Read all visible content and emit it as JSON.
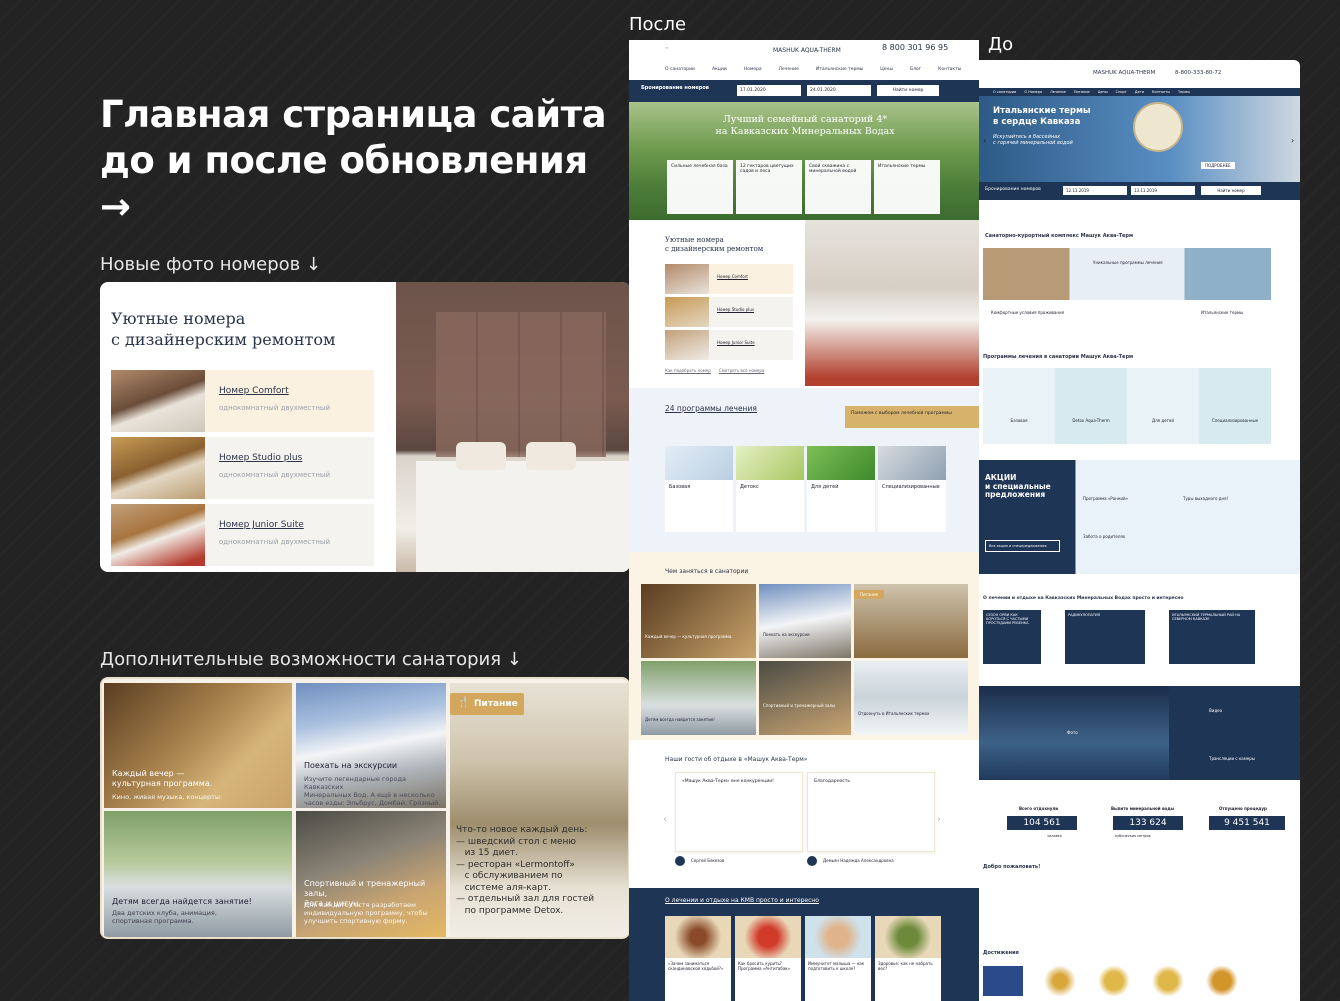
{
  "headline": [
    "Главная страница сайта",
    "до и после обновления →"
  ],
  "labels": {
    "after": "После",
    "before": "До",
    "rooms_section": "Новые фото номеров ↓",
    "features_section": "Дополнительные возможности санатория ↓"
  },
  "rooms_card": {
    "title_line1": "Уютные номера",
    "title_line2": "с дизайнерским ремонтом",
    "rooms": [
      {
        "name": "Номер Comfort",
        "subtitle": "однокомнатный двухместный"
      },
      {
        "name": "Номер Studio plus",
        "subtitle": "однокомнатный двухместный"
      },
      {
        "name": "Номер Junior Suite",
        "subtitle": "однокомнатный двухместный"
      }
    ]
  },
  "features_card": {
    "tiles": [
      {
        "title": "Каждый вечер —\nкультурная программа.",
        "subtitle": "Кино, живая музыка, концерты."
      },
      {
        "title": "Поехать на экскурсии",
        "subtitle": "Изучите легендарные города Кавказских\nМинеральных Вод. А ещё в несколько\nчасов езды: Эльбрус, Домбай, Грозный."
      },
      {
        "title": "Питание",
        "subtitle": ""
      },
      {
        "title": "Детям всегда найдется занятие!",
        "subtitle": "Два детских клуба, анимация,\nспортивная программа."
      },
      {
        "title": "Спортивный и тренажерный залы,\nйога и цигун.",
        "subtitle": "Для каждого гостя разработаем\nиндивидуальную программу, чтобы\nулучшить спортивную форму."
      }
    ],
    "food_text": {
      "heading": "Что-то новое каждый день:",
      "items": [
        "— шведский стол с меню",
        "   из 15 диет.",
        "— ресторан «Lermontoff»",
        "   с обслуживанием по",
        "   системе аля-карт.",
        "— отдельный зал для гостей",
        "   по программе Detox."
      ]
    }
  },
  "after_site": {
    "logo": "MASHUK AQUA-THERM",
    "phone": "8 800 301 96 95",
    "nav": [
      "О санатории",
      "Акции",
      "Номера",
      "Лечение",
      "Итальянские термы",
      "Цены",
      "Блог",
      "Контакты"
    ],
    "booking": {
      "label": "Бронирование номеров",
      "checkin": "17.01.2020",
      "checkout": "24.01.2020",
      "button": "Найти номер"
    },
    "hero_title": "Лучший семейный санаторий 4*\nна Кавказских Минеральных Водах",
    "hero_features": [
      "Сильные лечебная база",
      "12 гектаров цветущих садов и леса",
      "Свой скважина с минеральной водой",
      "Итальянские термы"
    ],
    "rooms_title": "Уютные номера\nс дизайнерским ремонтом",
    "rooms": [
      "Номер Comfort",
      "Номер Studio plus",
      "Номер Junior Suite"
    ],
    "rooms_links": [
      "Как подобрать номер",
      "Смотреть все номера"
    ],
    "programs_title": "24 программы лечения",
    "programs_promo": "Поможем с выбором лечебной программы",
    "programs": [
      "Базовая",
      "Детокс",
      "Для детей",
      "Специализированные"
    ],
    "activities_title": "Чем заняться в санатории",
    "activities": [
      "Каждый вечер — культурная программа.",
      "Поехать на экскурсии",
      "Питание",
      "Детям всегда найдется занятие!",
      "Спортивный и тренажерный залы",
      "Отдохнуть в Итальянских термах"
    ],
    "reviews_title": "Наши гости об отдыхе в «Машук Аква-Терм»",
    "reviews": [
      {
        "title": "«Машук Аква-Терм» вне конкуренции!",
        "author": "Сергей Бекезов"
      },
      {
        "title": "Благодарность",
        "author": "Демьян Надежда Александровна"
      }
    ],
    "blog_title": "О лечении и отдыхе на КМВ просто и интересно",
    "blog": [
      "«Зачем заниматься скандинавской ходьбой?»",
      "Как бросить курить? Программа «Антитабак»",
      "Иммунитет малыша — как подготовить к школе?",
      "Здоровье: как не набрать вес?"
    ]
  },
  "before_site": {
    "logo": "MASHUK AQUA-THERM",
    "phone": "8-800-333-80-72",
    "nav": [
      "О санатории",
      "О Номера",
      "Лечение",
      "Питание",
      "Цены",
      "Спорт",
      "Дети",
      "Контакты",
      "Термы"
    ],
    "hero_title": "Итальянские термы\nв сердце Кавказа",
    "hero_subtitle": "Искупайтесь в бассейнах\nс горячей минеральной водой",
    "hero_badge": "ПОДРОБНЕЕ",
    "booking": {
      "label": "Бронирование номеров",
      "checkin": "12.11.2019",
      "checkout": "13.11.2019",
      "button": "Найти номер"
    },
    "complex_title": "Санаторно-курортный комплекс Машук Аква-Терм",
    "complex_tiles": [
      "Уникальные программы лечения",
      "Комфортные условия проживания",
      "Итальянские термы"
    ],
    "programs_title": "Программы лечения в санатории Машук Аква-Терм",
    "programs": [
      "Базовая",
      "Detox Aqua-Therm",
      "Для детей",
      "Специализированные"
    ],
    "promo_title": "АКЦИИ\nи специальные\nпредложения",
    "promo_button": "Все акции и спецпредложения",
    "promo_items": [
      "Программа «Ранний»",
      "Туры выходного дня!",
      "Забота о родителях"
    ],
    "blog_title": "О лечении и отдыхе на Кавказских Минеральных Водах просто и интересно",
    "blog": [
      "СЕЗОН ОРВИ КАК БОРОТЬСЯ С ЧАСТЫМИ ПРОСТУДАМИ РЕБЕНКА",
      "РАДИКУЛОПАТИЯ",
      "ИТАЛЬЯНСКИЙ ТЕРМАЛЬНЫЙ РАЙ НА СЕВЕРНОМ КАВКАЗЕ"
    ],
    "media": [
      "Фото",
      "Видео",
      "Трансляции с камеры"
    ],
    "stats": [
      {
        "label": "Всего отдохнули",
        "value": "104 561",
        "unit": "человек"
      },
      {
        "label": "Выпито минеральной воды",
        "value": "133 624",
        "unit": "кубических метров"
      },
      {
        "label": "Отпущено процедур",
        "value": "9 451 541",
        "unit": ""
      }
    ],
    "welcome_title": "Добро пожаловать!",
    "achievements_title": "Достижения"
  },
  "colors": {
    "background": "#232323",
    "navy": "#1f3556",
    "gold": "#d7b26a",
    "cream": "#fbf3e3"
  }
}
